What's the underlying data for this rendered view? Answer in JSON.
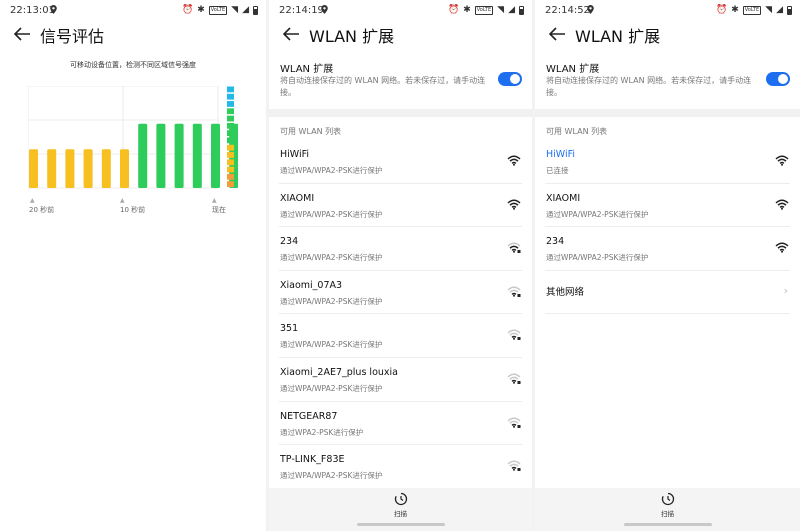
{
  "screen1": {
    "time": "22:13:01",
    "title": "信号评估",
    "hint": "可移动设备位置，检测不同区域信号强度",
    "x_labels": [
      "20 秒前",
      "10 秒前",
      "现在"
    ]
  },
  "screen2": {
    "time": "22:14:19",
    "title": "WLAN 扩展",
    "toggle_title": "WLAN 扩展",
    "toggle_desc": "将自动连接保存过的 WLAN 网络。若未保存过，请手动连接。",
    "section": "可用 WLAN 列表",
    "networks": [
      {
        "name": "HiWiFi",
        "sub": "通过WPA/WPA2-PSK进行保护",
        "signal": "strong"
      },
      {
        "name": "XIAOMI",
        "sub": "通过WPA/WPA2-PSK进行保护",
        "signal": "strong"
      },
      {
        "name": "234",
        "sub": "通过WPA/WPA2-PSK进行保护",
        "signal": "medium"
      },
      {
        "name": "Xiaomi_07A3",
        "sub": "通过WPA/WPA2-PSK进行保护",
        "signal": "weak"
      },
      {
        "name": "351",
        "sub": "通过WPA/WPA2-PSK进行保护",
        "signal": "weak"
      },
      {
        "name": "Xiaomi_2AE7_plus louxia",
        "sub": "通过WPA/WPA2-PSK进行保护",
        "signal": "weak"
      },
      {
        "name": "NETGEAR87",
        "sub": "通过WPA2-PSK进行保护",
        "signal": "weak"
      },
      {
        "name": "TP-LINK_F83E",
        "sub": "通过WPA/WPA2-PSK进行保护",
        "signal": "weak"
      }
    ],
    "scan_label": "扫描"
  },
  "screen3": {
    "time": "22:14:52",
    "title": "WLAN 扩展",
    "toggle_title": "WLAN 扩展",
    "toggle_desc": "将自动连接保存过的 WLAN 网络。若未保存过，请手动连接。",
    "section": "可用 WLAN 列表",
    "networks": [
      {
        "name": "HiWiFi",
        "sub": "已连接",
        "signal": "strong",
        "active": true
      },
      {
        "name": "XIAOMI",
        "sub": "通过WPA/WPA2-PSK进行保护",
        "signal": "strong"
      },
      {
        "name": "234",
        "sub": "通过WPA/WPA2-PSK进行保护",
        "signal": "strong"
      }
    ],
    "other_networks": "其他网络",
    "scan_label": "扫描"
  },
  "status_icons": [
    "alarm-icon",
    "bluetooth-icon",
    "volte-badge",
    "wifi-icon",
    "signal-icon",
    "battery-icon"
  ],
  "volte_text": "VoLTE",
  "colors": {
    "accent": "#1e6ff0",
    "bar_yellow": "#f7bf1f",
    "bar_green": "#2ecc5a"
  },
  "chart_data": {
    "type": "bar",
    "values": [
      0.38,
      0.38,
      0.38,
      0.38,
      0.38,
      0.38,
      0.63,
      0.63,
      0.63,
      0.63,
      0.63,
      0.63
    ],
    "series_colors": [
      "yellow",
      "yellow",
      "yellow",
      "yellow",
      "yellow",
      "yellow",
      "green",
      "green",
      "green",
      "green",
      "green",
      "green"
    ],
    "scale_colors": [
      "#22b8e8",
      "#22b8e8",
      "#22b8e8",
      "#2ecc5a",
      "#2ecc5a",
      "#2ecc5a",
      "#2ecc5a",
      "#2ecc5a",
      "#f7bf1f",
      "#f7bf1f",
      "#f7bf1f",
      "#f7bf1f",
      "#f59b3a",
      "#f59b3a"
    ],
    "grid": true,
    "ylim": [
      0,
      1
    ]
  }
}
